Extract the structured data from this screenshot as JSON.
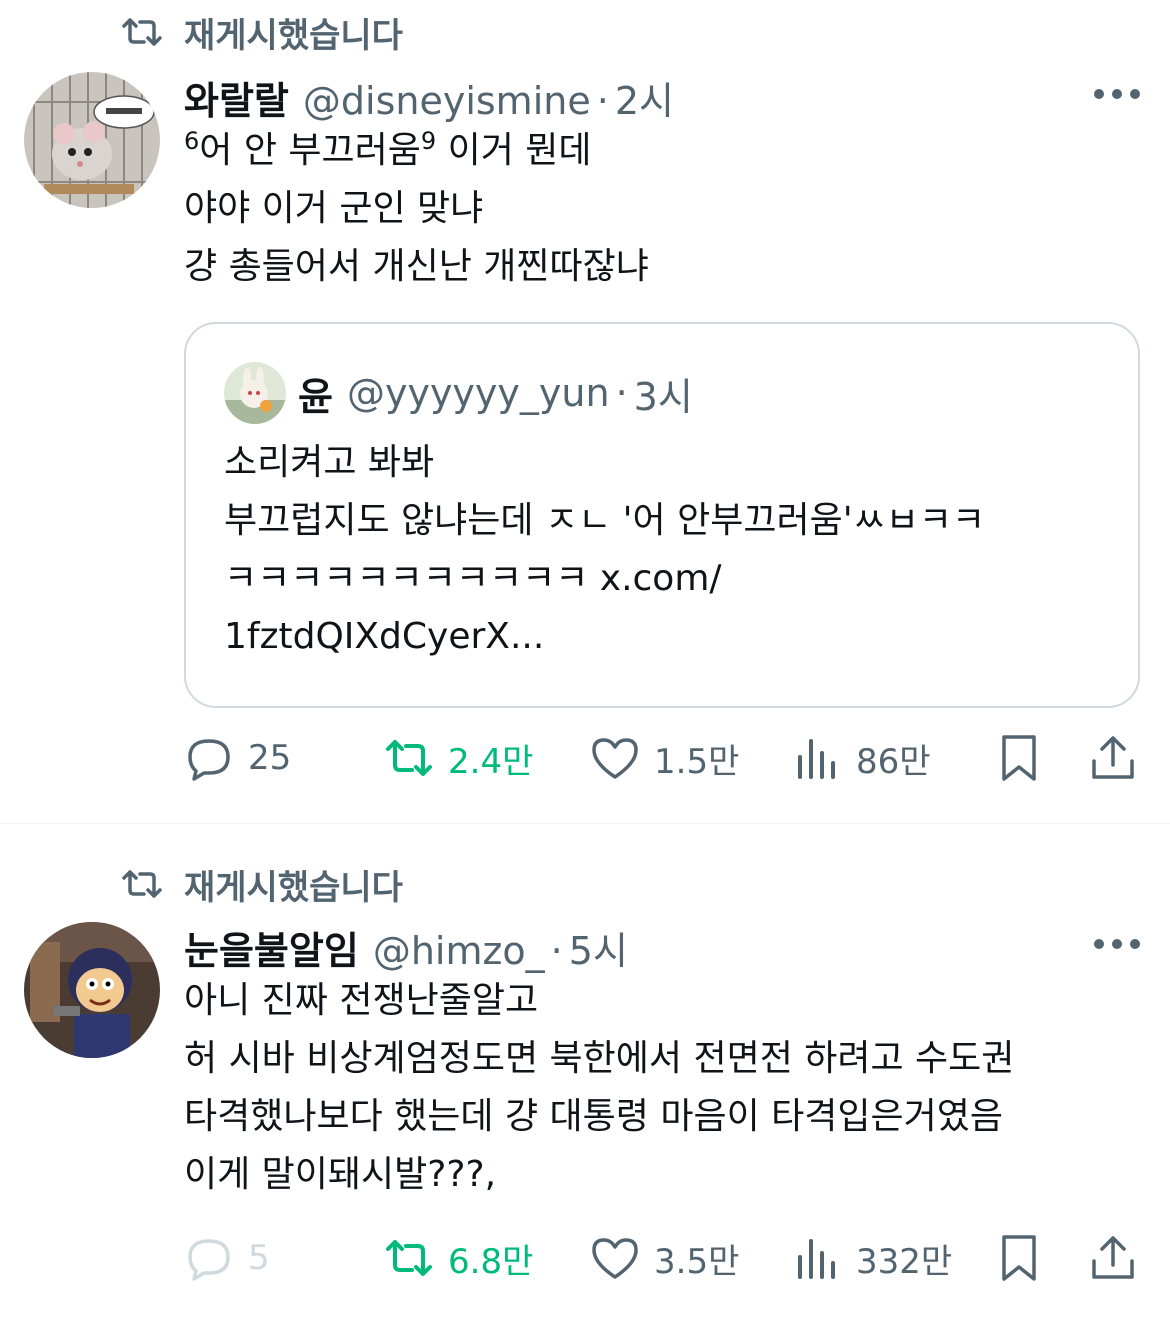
{
  "tweets": [
    {
      "repost_label": "재게시했습니다",
      "author_name": "와랄랄",
      "handle": "@disneyismine",
      "separator": "·",
      "time": "2시",
      "text_line1_a": "6",
      "text_line1_b": "어 안 부끄러움",
      "text_line1_c": "9",
      "text_line1_d": " 이거 뭔데",
      "text_line2": "야야 이거 군인 맞냐",
      "text_line3": "걍 총들어서 개신난 개찐따잖냐",
      "quote": {
        "author_name": "윤",
        "handle": "@yyyyyy_yun",
        "separator": "·",
        "time": "3시",
        "lines": [
          "소리켜고 봐봐",
          "부끄럽지도 않냐는데 ㅈㄴ '어 안부끄러움'ㅆㅂㅋㅋ",
          "ㅋㅋㅋㅋㅋㅋㅋㅋㅋㅋㅋ x.com/",
          "1fztdQIXdCyerX..."
        ]
      },
      "stats": {
        "replies": "25",
        "reposts": "2.4만",
        "likes": "1.5만",
        "views": "86만"
      }
    },
    {
      "repost_label": "재게시했습니다",
      "author_name": "눈을불알임",
      "handle": "@himzo_",
      "separator": "·",
      "time": "5시",
      "lines": [
        "아니 진짜 전쟁난줄알고",
        "허 시바 비상계엄정도면 북한에서 전면전 하려고 수도권",
        "타격했나보다 했는데 걍 대통령 마음이 타격입은거였음",
        "이게 말이돼시발???,"
      ],
      "stats": {
        "replies": "5",
        "reposts": "6.8만",
        "likes": "3.5만",
        "views": "332만"
      }
    }
  ],
  "colors": {
    "text": "#0f1419",
    "muted": "#536471",
    "repost_green": "#00ba7c",
    "border": "#cfd9de",
    "divider": "#eff3f4"
  },
  "icons": [
    "repost-icon",
    "more-icon",
    "reply-icon",
    "like-icon",
    "views-icon",
    "bookmark-icon",
    "share-icon"
  ]
}
